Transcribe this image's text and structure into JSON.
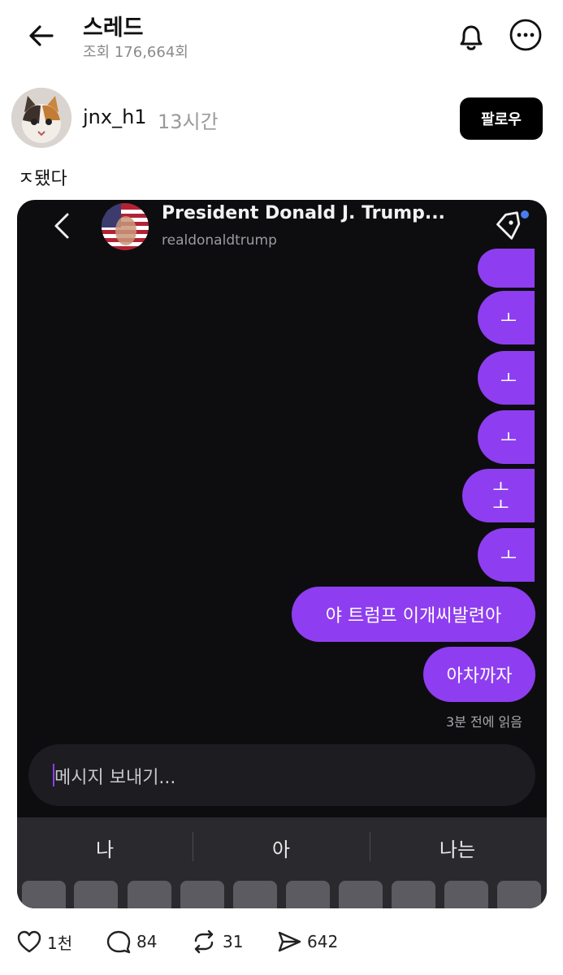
{
  "header": {
    "title": "스레드",
    "views": "조회 176,664회"
  },
  "post": {
    "username": "jnx_h1",
    "time": "13시간",
    "follow_label": "팔로우",
    "text": "ㅈ됐다"
  },
  "screenshot": {
    "dm_name": "President Donald J. Trump...",
    "dm_handle": "realdonaldtrump",
    "messages": [
      "ㅗ",
      "ㅗ",
      "ㅗ",
      "ㅗㅗ",
      "ㅗ",
      "야 트럼프 이개씨발련아",
      "아차까자"
    ],
    "read_status": "3분 전에 읽음",
    "input_placeholder": "메시지 보내기...",
    "suggestions": [
      "나",
      "아",
      "나는"
    ]
  },
  "actions": {
    "likes": "1천",
    "comments": "84",
    "reposts": "31",
    "shares": "642"
  },
  "colors": {
    "accent_bubble": "#8e3ef0",
    "dm_background": "#0d0d10"
  }
}
